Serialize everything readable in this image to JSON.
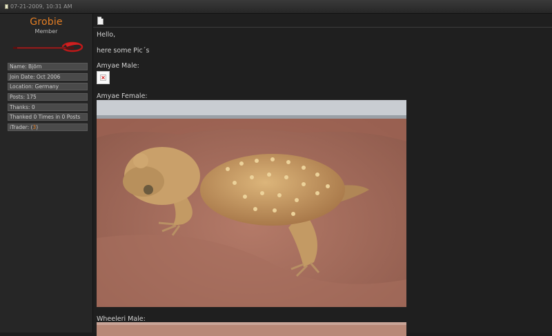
{
  "post_header": {
    "date": "07-21-2009, 10:31 AM"
  },
  "user": {
    "name": "Grobie",
    "title": "Member",
    "info": [
      {
        "text": "Name: Björn"
      },
      {
        "text": "Join Date: Oct 2006"
      },
      {
        "text": "Location: Germany"
      },
      {
        "text": "Posts: 175"
      },
      {
        "text": "Thanks: 0"
      },
      {
        "text": "Thanked 0 Times in 0 Posts"
      }
    ],
    "itrader_label": "iTrader: (",
    "itrader_value": "3",
    "itrader_close": ")"
  },
  "post": {
    "greeting": "Hello,",
    "intro": "here some Pic´s",
    "caption_male": "Amyae Male:",
    "caption_female": "Amyae Female:",
    "caption_wheeleri": "Wheeleri Male:"
  },
  "colors": {
    "username": "#e57f24",
    "background": "#1c1c1c",
    "sand": "#a86f5e",
    "lizard": "#c99e62"
  }
}
